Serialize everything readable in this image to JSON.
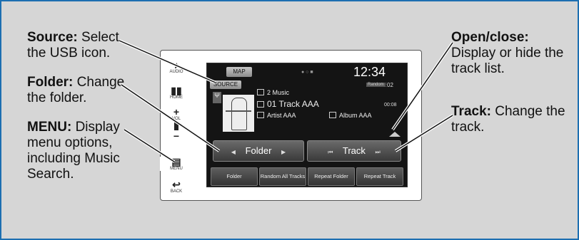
{
  "callouts": {
    "source": {
      "term": "Source:",
      "desc": "Select the USB icon."
    },
    "folder": {
      "term": "Folder:",
      "desc": "Change the folder."
    },
    "menu": {
      "term": "MENU:",
      "desc": "Display menu options, including Music Search."
    },
    "open_close": {
      "term": "Open/close:",
      "desc": "Display or hide the track list."
    },
    "track": {
      "term": "Track:",
      "desc": "Change the track."
    }
  },
  "side_panel": {
    "audio": "AUDIO",
    "home": "HOME",
    "vol_plus": "+",
    "vol": "VOL",
    "vol_minus": "−",
    "menu": "MENU",
    "back": "BACK"
  },
  "screen": {
    "map_button": "MAP",
    "source_button": "SOURCE",
    "clock": "12:34",
    "random_indicator": "Random",
    "track_number": "02",
    "folder_name": "2 Music",
    "track_title": "01 Track AAA",
    "artist": "Artist AAA",
    "album": "Album AAA",
    "elapsed": "00:08",
    "folder_button": "Folder",
    "track_button": "Track",
    "option_buttons": [
      "Folder",
      "Random All Tracks",
      "Repeat Folder",
      "Repeat Track"
    ]
  },
  "icons": {
    "usb": "usb-icon",
    "audio": "audio-icon",
    "home": "home-icon",
    "menu": "menu-icon",
    "back": "back-icon",
    "open_close": "chevron-up-icon"
  },
  "colors": {
    "frame_border": "#1d6fb1",
    "frame_background": "#d6d6d6",
    "screen_background": "#141414"
  }
}
